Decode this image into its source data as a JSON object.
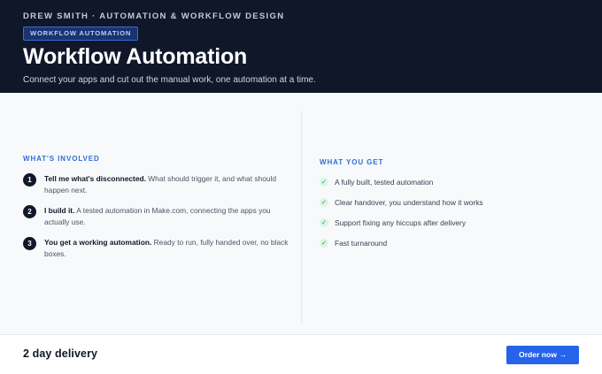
{
  "header": {
    "eyebrow": "DREW SMITH · AUTOMATION & WORKFLOW DESIGN",
    "badge": "WORKFLOW AUTOMATION",
    "title": "Workflow Automation",
    "subtitle": "Connect your apps and cut out the manual work, one automation at a time."
  },
  "involved": {
    "label": "WHAT'S INVOLVED",
    "steps": [
      {
        "num": "1",
        "title": "Tell me what's disconnected.",
        "text": " What should trigger it, and what should happen next."
      },
      {
        "num": "2",
        "title": "I build it.",
        "text": " A tested automation in Make.com, connecting the apps you actually use."
      },
      {
        "num": "3",
        "title": "You get a working automation.",
        "text": " Ready to run, fully handed over, no black boxes."
      }
    ]
  },
  "get": {
    "label": "WHAT YOU GET",
    "check_glyph": "✓",
    "items": [
      "A fully built, tested automation",
      "Clear handover, you understand how it works",
      "Support fixing any hiccups after delivery",
      "Fast turnaround"
    ]
  },
  "footer": {
    "delivery": "2 day delivery",
    "order_label": "Order now →"
  },
  "colors": {
    "header_bg": "#0f1729",
    "accent": "#2563eb",
    "check": "#22a35a"
  }
}
